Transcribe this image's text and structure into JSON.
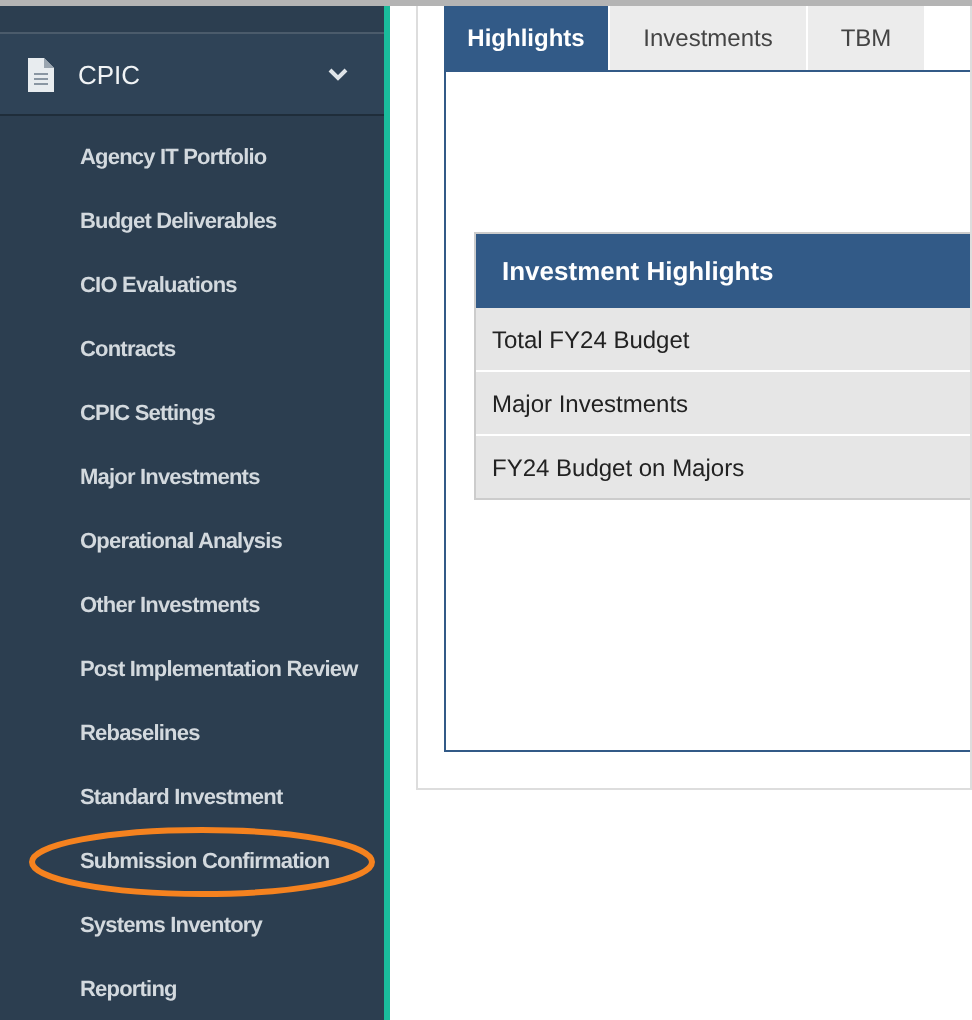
{
  "sidebar": {
    "section": {
      "label": "CPIC",
      "expanded": true
    },
    "items": [
      {
        "label": "Agency IT Portfolio",
        "circled": false
      },
      {
        "label": "Budget Deliverables",
        "circled": false
      },
      {
        "label": "CIO Evaluations",
        "circled": false
      },
      {
        "label": "Contracts",
        "circled": false
      },
      {
        "label": "CPIC Settings",
        "circled": false
      },
      {
        "label": "Major Investments",
        "circled": false
      },
      {
        "label": "Operational Analysis",
        "circled": false
      },
      {
        "label": "Other Investments",
        "circled": false
      },
      {
        "label": "Post Implementation Review",
        "circled": false
      },
      {
        "label": "Rebaselines",
        "circled": false
      },
      {
        "label": "Standard Investment",
        "circled": false
      },
      {
        "label": "Submission Confirmation",
        "circled": true
      },
      {
        "label": "Systems Inventory",
        "circled": false
      },
      {
        "label": "Reporting",
        "circled": false
      }
    ]
  },
  "tabs": [
    {
      "label": "Highlights",
      "selected": true
    },
    {
      "label": "Investments",
      "selected": false
    },
    {
      "label": "TBM",
      "selected": false
    }
  ],
  "table": {
    "title": "Investment Highlights",
    "rows": [
      {
        "label": "Total FY24 Budget"
      },
      {
        "label": "Major Investments"
      },
      {
        "label": "FY24 Budget on Majors"
      }
    ]
  }
}
